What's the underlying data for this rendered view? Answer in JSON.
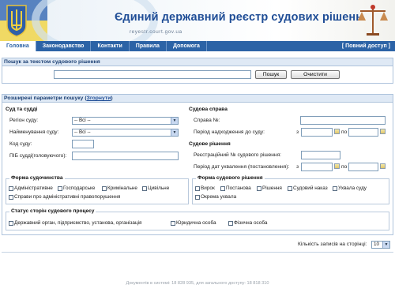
{
  "header": {
    "title": "Єдиний державний реєстр судових рішень",
    "url": "reyestr.court.gov.ua"
  },
  "nav": {
    "items": [
      "Головна",
      "Законодавство",
      "Контакти",
      "Правила",
      "Допомога"
    ],
    "full_access": "[ Повний доступ ]"
  },
  "search": {
    "title": "Пошук за текстом судового рішення",
    "query": "",
    "search_button": "Пошук",
    "clear_button": "Очистити"
  },
  "advanced": {
    "title_prefix": "Розширені параметри пошуку (",
    "collapse_link": "Згорнути",
    "title_suffix": ")",
    "court": {
      "heading": "Суд та судді",
      "region_label": "Регіон суду:",
      "region_value": "-- Всі --",
      "court_name_label": "Найменування суду:",
      "court_name_value": "-- Всі --",
      "code_label": "Код суду:",
      "judge_label": "ПІБ судді(головуючого):"
    },
    "case": {
      "heading": "Судова справа",
      "case_no_label": "Справа №:",
      "period_label": "Період надходження до суду:",
      "from": "з",
      "to": "по"
    },
    "decision": {
      "heading": "Судове рішення",
      "reg_no_label": "Реєстраційний № судового рішення:",
      "date_label": "Період дат ухвалення (постановлення):",
      "from": "з",
      "to": "по"
    },
    "justice_form": {
      "title": "Форма судочинства",
      "options": [
        "Адміністративне",
        "Господарське",
        "Кримінальне",
        "Цивільне",
        "Справи про адміністративні правопорушення"
      ]
    },
    "decision_form": {
      "title": "Форма судового рішення",
      "options": [
        "Вирок",
        "Постанова",
        "Рішення",
        "Судовий наказ",
        "Ухвала суду",
        "Окрема ухвала"
      ]
    },
    "party_status": {
      "title": "Статус сторін судового процесу",
      "options": [
        "Державний орган, підприємство, установа, організація",
        "Юридична особа",
        "Фізична особа"
      ]
    }
  },
  "pagination": {
    "label": "Кількість записів на сторінці:",
    "value": "10"
  },
  "footer": {
    "counts": "Документів в системі: 18 828 935, для загального доступу: 18 818 310"
  }
}
